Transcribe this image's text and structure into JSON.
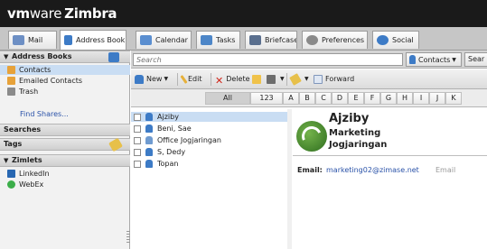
{
  "brand": {
    "vm": "vm",
    "ware": "ware",
    "app": "Zimbra"
  },
  "tabs": [
    {
      "label": "Mail",
      "icon": "mail-icon"
    },
    {
      "label": "Address Book",
      "icon": "address-book-icon",
      "active": true
    },
    {
      "label": "Calendar",
      "icon": "calendar-icon"
    },
    {
      "label": "Tasks",
      "icon": "tasks-icon"
    },
    {
      "label": "Briefcase",
      "icon": "briefcase-icon"
    },
    {
      "label": "Preferences",
      "icon": "preferences-icon"
    },
    {
      "label": "Social",
      "icon": "social-icon"
    }
  ],
  "sidebar": {
    "address_books_header": "Address Books",
    "address_books": [
      {
        "label": "Contacts",
        "icon": "contacts-book-icon",
        "selected": true
      },
      {
        "label": "Emailed Contacts",
        "icon": "emailed-contacts-icon"
      },
      {
        "label": "Trash",
        "icon": "trash-icon"
      }
    ],
    "find_shares": "Find Shares...",
    "searches_header": "Searches",
    "tags_header": "Tags",
    "zimlets_header": "Zimlets",
    "zimlets": [
      {
        "label": "LinkedIn",
        "icon": "linkedin-icon"
      },
      {
        "label": "WebEx",
        "icon": "webex-icon"
      }
    ]
  },
  "search": {
    "placeholder": "Search",
    "scope": "Contacts",
    "button": "Sear"
  },
  "toolbar": {
    "new": "New",
    "edit": "Edit",
    "delete": "Delete",
    "forward": "Forward"
  },
  "alphabet": [
    "All",
    "123",
    "A",
    "B",
    "C",
    "D",
    "E",
    "F",
    "G",
    "H",
    "I",
    "J",
    "K"
  ],
  "contacts": [
    {
      "name": "Ajziby",
      "type": "person",
      "selected": true
    },
    {
      "name": "Beni, Sae",
      "type": "person"
    },
    {
      "name": "Office Jogjaringan",
      "type": "group"
    },
    {
      "name": "S, Dedy",
      "type": "person"
    },
    {
      "name": "Topan",
      "type": "person"
    }
  ],
  "detail": {
    "name": "Ajziby",
    "department": "Marketing",
    "company": "Jogjaringan",
    "email_label": "Email:",
    "email": "marketing02@zimase.net",
    "email_type": "Email"
  },
  "colors": {
    "header_bg": "#1a1a1a",
    "selection": "#c9ddf3",
    "link": "#2a52a8",
    "delete_red": "#d0261a"
  }
}
